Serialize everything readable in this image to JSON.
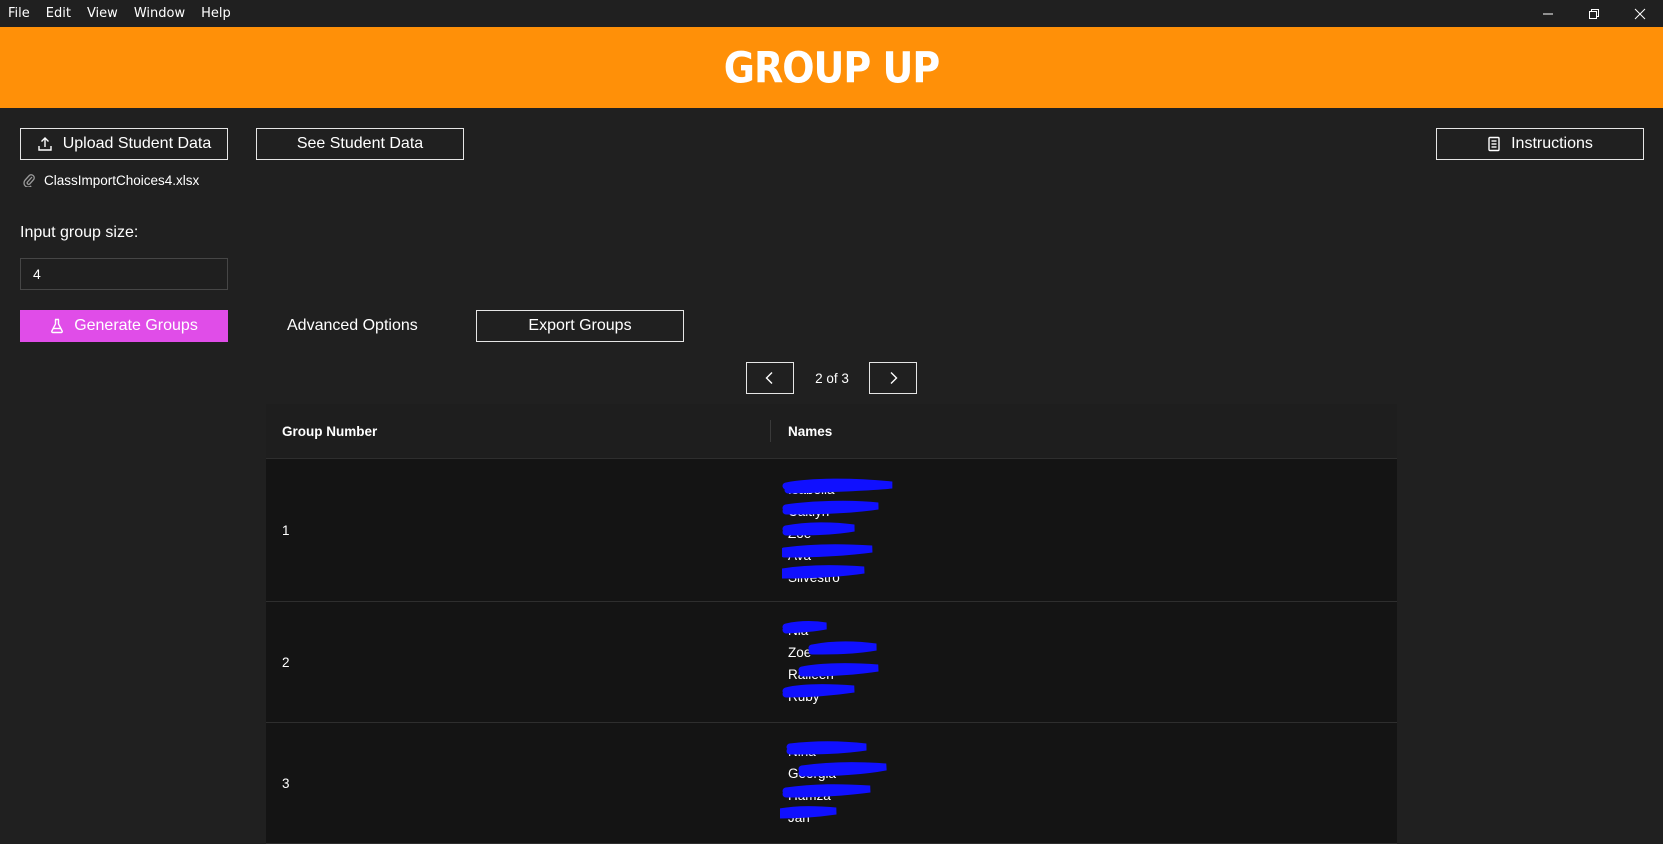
{
  "menu": [
    "File",
    "Edit",
    "View",
    "Window",
    "Help"
  ],
  "header": {
    "title": "GROUP UP"
  },
  "actions": {
    "upload_label": "Upload Student Data",
    "see_label": "See Student Data",
    "instructions_label": "Instructions",
    "file_name": "ClassImportChoices4.xlsx",
    "size_label": "Input group size:",
    "size_value": "4",
    "generate_label": "Generate Groups",
    "advanced_label": "Advanced Options",
    "export_label": "Export Groups"
  },
  "pager": {
    "text": "2 of 3"
  },
  "table": {
    "headers": {
      "group": "Group Number",
      "names": "Names"
    },
    "rows": [
      {
        "group": "1",
        "names": [
          "Isabella",
          "Caitlyn",
          "Zoe",
          "Ava",
          "Silvestro"
        ]
      },
      {
        "group": "2",
        "names": [
          "Nia",
          "Zoe",
          "Raileen",
          "Ruby"
        ]
      },
      {
        "group": "3",
        "names": [
          "Nina",
          "Georgia",
          "Hamza",
          "Jan"
        ]
      }
    ]
  },
  "colors": {
    "header_bg": "#ff9008",
    "generate_bg": "#e04de8",
    "redaction": "#1010ff"
  },
  "icons": {
    "upload": "upload-icon",
    "attachment": "paperclip-icon",
    "instructions": "document-icon",
    "generate": "flask-icon",
    "prev": "chevron-left-icon",
    "next": "chevron-right-icon"
  }
}
